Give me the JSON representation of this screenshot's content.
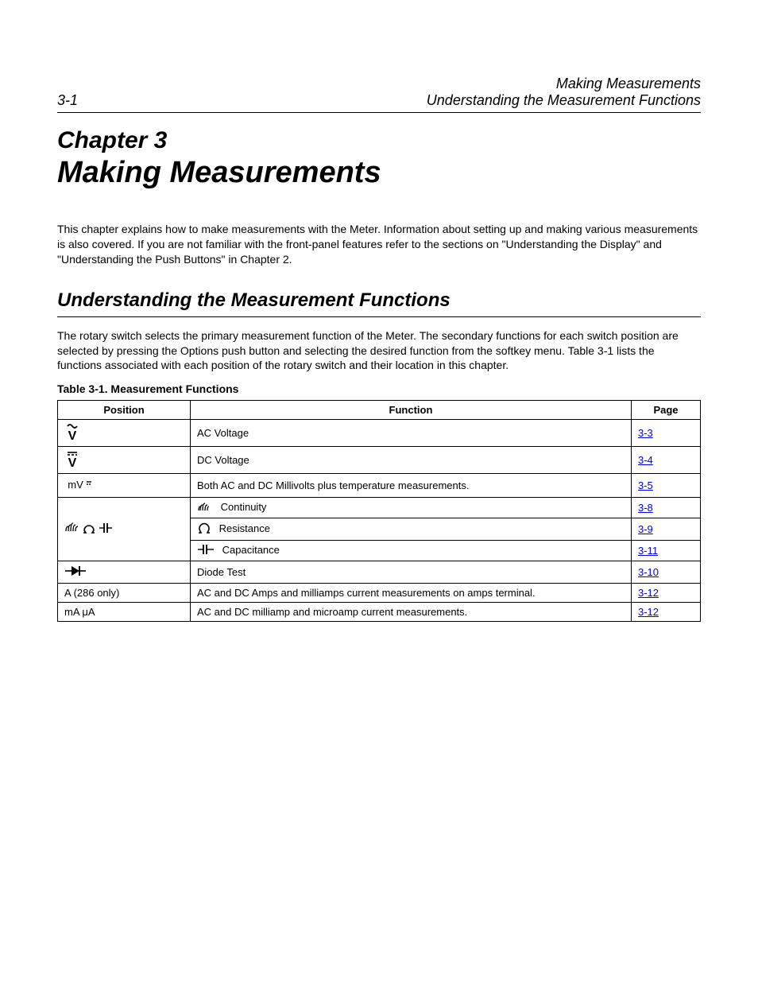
{
  "header": {
    "page_number": "3-1",
    "right_line1": "Making Measurements",
    "right_line2": "Understanding the Measurement Functions"
  },
  "chapter": "Chapter 3",
  "title": "Making Measurements",
  "intro": "This chapter explains how to make measurements with the Meter. Information about setting up and making various measurements is also covered. If you are not familiar with the front-panel features refer to the sections on \"Understanding the Display\" and \"Understanding the Push Buttons\" in Chapter 2.",
  "section": {
    "heading": "Understanding the Measurement Functions",
    "body": "The rotary switch selects the primary measurement function of the Meter. The secondary functions for each switch position are selected by pressing the Options push button and selecting the desired function from the softkey menu. Table 3-1 lists the functions associated with each position of the rotary switch and their location in this chapter."
  },
  "table": {
    "caption": "Table 3-1. Measurement Functions",
    "headers": [
      "Position",
      "Function",
      "Page"
    ],
    "rows": [
      {
        "position": "ac-v",
        "function": "AC Voltage",
        "page": "3-3"
      },
      {
        "position": "dc-v",
        "function": "DC Voltage",
        "page": "3-4"
      },
      {
        "position": "mv",
        "function": "Both AC and DC Millivolts plus temperature measurements.",
        "page": "3-5"
      },
      {
        "position": "cont-ohm-cap",
        "function_icon": "cont",
        "function": "Continuity",
        "page": "3-8"
      },
      {
        "position": "",
        "function_icon": "ohm",
        "function": "Resistance",
        "page": "3-9"
      },
      {
        "position": "",
        "function_icon": "cap",
        "function": "Capacitance",
        "page": "3-11"
      },
      {
        "position": "diode",
        "function": "Diode Test",
        "page": "3-10"
      },
      {
        "position": "A (286 only)",
        "function": "AC and DC Amps and milliamps current measurements on amps terminal.",
        "page": "3-12"
      },
      {
        "position": "mA μA",
        "function": "AC and DC milliamp and microamp current measurements.",
        "page": "3-12"
      }
    ]
  }
}
